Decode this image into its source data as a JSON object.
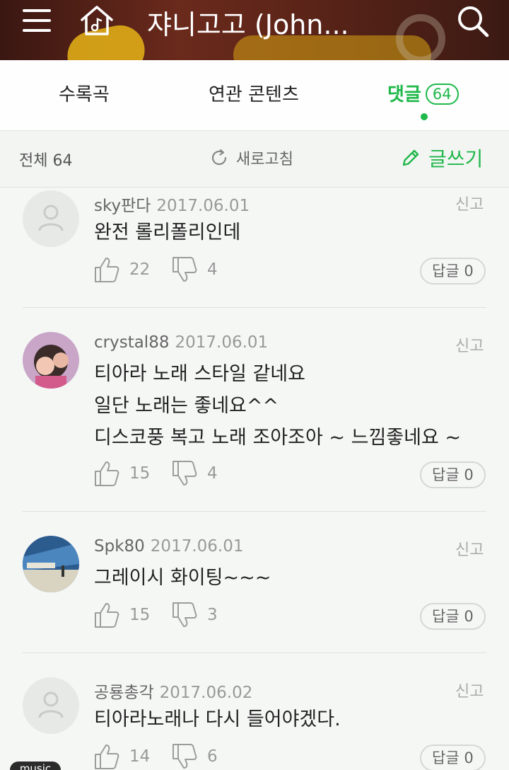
{
  "header": {
    "title": "쟈니고고 (John...",
    "icons": [
      "menu-icon",
      "home-music-icon",
      "search-icon"
    ]
  },
  "tabs": [
    {
      "label": "수록곡"
    },
    {
      "label": "연관 콘텐츠"
    },
    {
      "label": "댓글",
      "badge": "64",
      "active": true
    }
  ],
  "toolbar": {
    "total": "전체 64",
    "refresh": "새로고침",
    "write": "글쓰기"
  },
  "colors": {
    "accent": "#1fb84a"
  },
  "comments": [
    {
      "user": "sky판다",
      "date": "2017.06.01",
      "report": "신고",
      "text": "완전 롤리폴리인데",
      "likes": "22",
      "dislikes": "4",
      "reply": "답글 0",
      "avatar": "default"
    },
    {
      "user": "crystal88",
      "date": "2017.06.01",
      "report": "신고",
      "text": "티아라 노래 스타일 같네요\n일단 노래는 좋네요^^\n디스코풍 복고 노래 조아조아 ~ 느낌좋네요 ~",
      "likes": "15",
      "dislikes": "4",
      "reply": "답글 0",
      "avatar": "photo"
    },
    {
      "user": "Spk80",
      "date": "2017.06.01",
      "report": "신고",
      "text": "그레이시 화이팅~~~",
      "likes": "15",
      "dislikes": "3",
      "reply": "답글 0",
      "avatar": "photo"
    },
    {
      "user": "공룡총각",
      "date": "2017.06.02",
      "report": "신고",
      "text": "티아라노래나 다시 들어야겠다.",
      "likes": "14",
      "dislikes": "6",
      "reply": "답글 0",
      "avatar": "default"
    }
  ],
  "music_pill": "music"
}
